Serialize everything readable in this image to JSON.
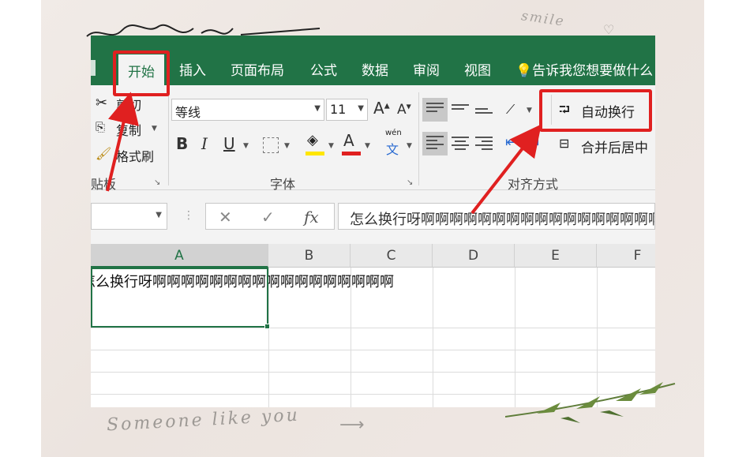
{
  "decor": {
    "smile": "smile",
    "bottom_text": "Someone like you"
  },
  "tabs": [
    {
      "label": "开始",
      "active": true
    },
    {
      "label": "插入"
    },
    {
      "label": "页面布局"
    },
    {
      "label": "公式"
    },
    {
      "label": "数据"
    },
    {
      "label": "审阅"
    },
    {
      "label": "视图"
    }
  ],
  "tellme": "告诉我您想要做什么",
  "clipboard": {
    "cut": "剪切",
    "copy": "复制",
    "format_painter": "格式刷",
    "group_label": "贴板"
  },
  "font": {
    "name": "等线",
    "size": "11",
    "bold": "B",
    "italic": "I",
    "underline": "U",
    "fill_icon": "paint-bucket-icon",
    "font_color_letter": "A",
    "phonetic_top": "wén",
    "phonetic_bottom": "文",
    "group_label": "字体",
    "grow_letter": "A",
    "shrink_letter": "A"
  },
  "alignment": {
    "wrap_text": "自动换行",
    "merge_center": "合并后居中",
    "group_label": "对齐方式"
  },
  "formula_bar": {
    "fx": "fx",
    "cancel": "✕",
    "enter": "✓",
    "content": "怎么换行呀啊啊啊啊啊啊啊啊啊啊啊啊啊啊啊啊啊"
  },
  "columns": [
    "A",
    "B",
    "C",
    "D",
    "E",
    "F"
  ],
  "cell_A1": "怎么换行呀啊啊啊啊啊啊啊啊啊啊啊啊啊啊啊啊啊",
  "colors": {
    "excel_green": "#217346",
    "annotation_red": "#e02020"
  }
}
